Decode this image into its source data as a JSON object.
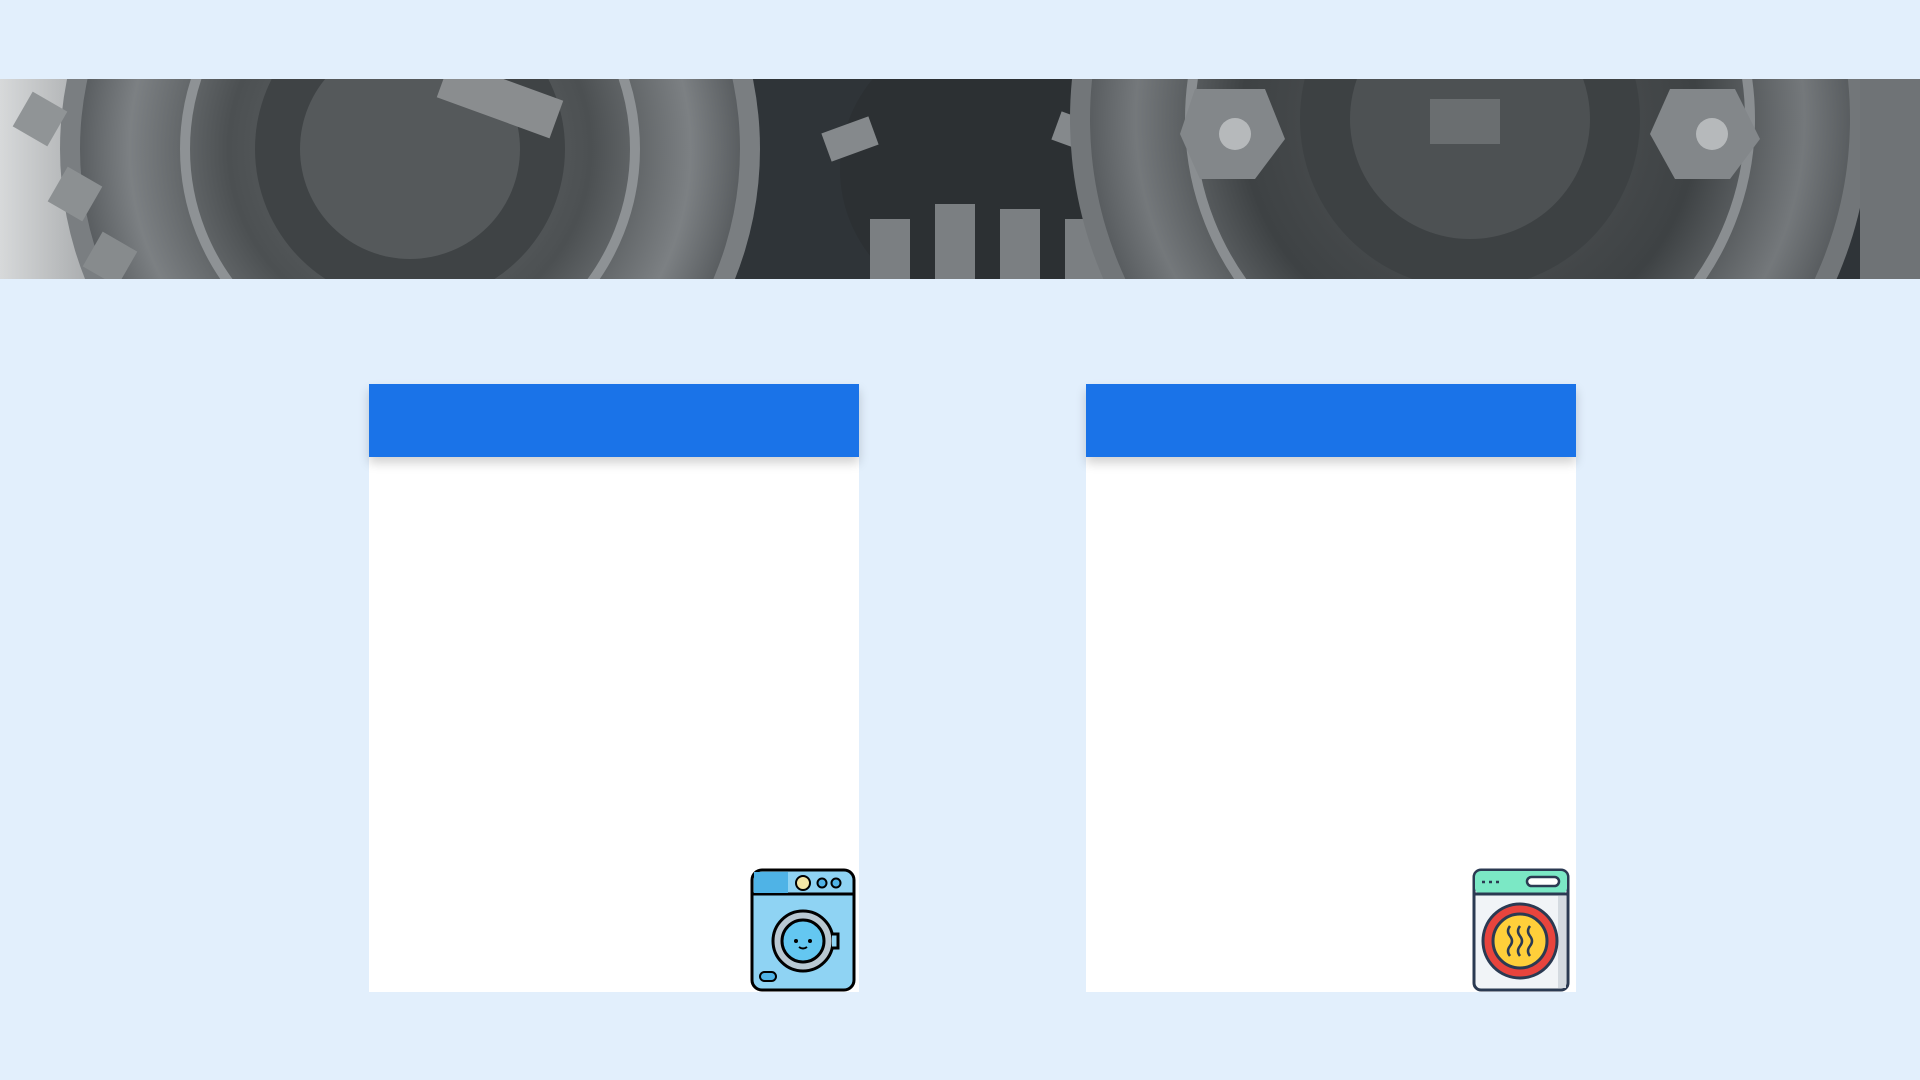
{
  "slide": {
    "banner": {
      "image": "machine-gears-photo"
    },
    "cards": [
      {
        "title": "",
        "body": "",
        "icon": "washing-machine-icon",
        "header_color": "#1a73e8",
        "icon_colors": {
          "body": "#8fd3f3",
          "door": "#64c7f1",
          "outline": "#000000",
          "accent": "#f3e7a6"
        }
      },
      {
        "title": "",
        "body": "",
        "icon": "dryer-icon",
        "header_color": "#1a73e8",
        "icon_colors": {
          "body": "#f1f4f7",
          "panel": "#7be8c5",
          "ring": "#e8443d",
          "inner": "#ffcf3a",
          "outline": "#2b3a52"
        }
      }
    ],
    "background_color": "#e2effc"
  }
}
